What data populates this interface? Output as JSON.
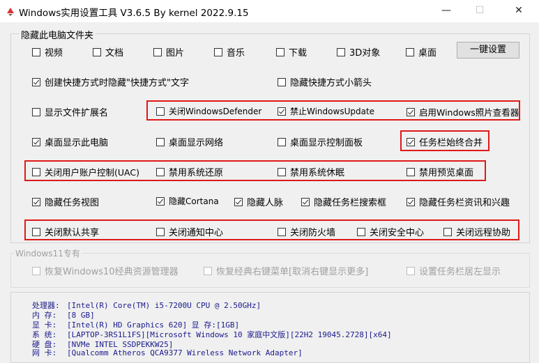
{
  "title": "Windows实用设置工具 V3.6.5 By kernel 2022.9.15",
  "window_controls": {
    "minimize": "—",
    "maximize": "☐",
    "close": "✕"
  },
  "group_hide_folders": {
    "title": "隐藏此电脑文件夹",
    "items": [
      "视频",
      "文档",
      "图片",
      "音乐",
      "下载",
      "3D对象",
      "桌面"
    ],
    "button": "一键设置"
  },
  "options": {
    "r1": [
      {
        "label": "创建快捷方式时隐藏\"快捷方式\"文字",
        "checked": true
      },
      {
        "label": "隐藏快捷方式小箭头",
        "checked": false
      }
    ],
    "r2": [
      {
        "label": "显示文件扩展名",
        "checked": false
      },
      {
        "label": "关闭WindowsDefender",
        "checked": false
      },
      {
        "label": "禁止WindowsUpdate",
        "checked": true
      },
      {
        "label": "启用Windows照片查看器",
        "checked": true
      }
    ],
    "r3": [
      {
        "label": "桌面显示此电脑",
        "checked": true
      },
      {
        "label": "桌面显示网络",
        "checked": false
      },
      {
        "label": "桌面显示控制面板",
        "checked": false
      },
      {
        "label": "任务栏始终合并",
        "checked": true
      }
    ],
    "r4": [
      {
        "label": "关闭用户账户控制(UAC)",
        "checked": false
      },
      {
        "label": "禁用系统还原",
        "checked": false
      },
      {
        "label": "禁用系统休眠",
        "checked": false
      },
      {
        "label": "禁用预览桌面",
        "checked": false
      }
    ],
    "r5": [
      {
        "label": "隐藏任务视图",
        "checked": true
      },
      {
        "label": "隐藏Cortana",
        "checked": true
      },
      {
        "label": "隐藏人脉",
        "checked": true
      },
      {
        "label": "隐藏任务栏搜索框",
        "checked": true
      },
      {
        "label": "隐藏任务栏资讯和兴趣",
        "checked": true
      }
    ],
    "r6": [
      {
        "label": "关闭默认共享",
        "checked": false
      },
      {
        "label": "关闭通知中心",
        "checked": false
      },
      {
        "label": "关闭防火墙",
        "checked": false
      },
      {
        "label": "关闭安全中心",
        "checked": false
      },
      {
        "label": "关闭远程协助",
        "checked": false
      }
    ]
  },
  "win11": {
    "title": "Windows11专有",
    "items": [
      "恢复Windows10经典资源管理器",
      "恢复经典右键菜单[取消右键显示更多]",
      "设置任务栏居左显示"
    ]
  },
  "sysinfo": [
    {
      "label": "处理器:",
      "value": "[Intel(R) Core(TM) i5-7200U CPU @ 2.50GHz]"
    },
    {
      "label": "内  存:",
      "value": "[8 GB]"
    },
    {
      "label": "显  卡:",
      "value": "[Intel(R) HD Graphics 620]  显 存:[1GB]"
    },
    {
      "label": "系  统:",
      "value": "[LAPTOP-3RS1L1FS][Microsoft Windows 10 家庭中文版][22H2 19045.2728][x64]"
    },
    {
      "label": "硬  盘:",
      "value": "[NVMe INTEL SSDPEKKW25]"
    },
    {
      "label": "网  卡:",
      "value": "[Qualcomm Atheros QCA9377 Wireless Network Adapter]"
    }
  ],
  "accent_color": "#e01818"
}
